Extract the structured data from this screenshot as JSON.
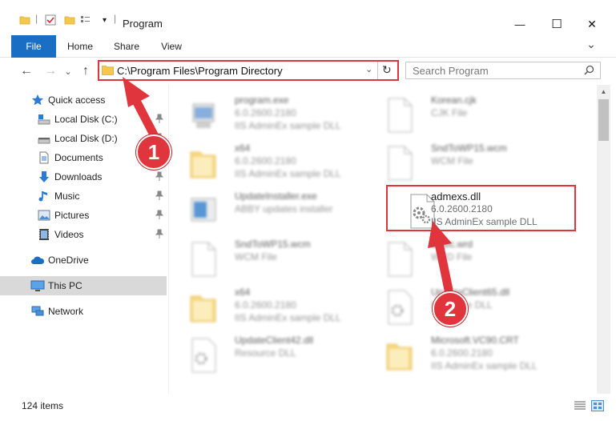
{
  "window": {
    "title": "Program",
    "minimize": "—",
    "maximize": "☐",
    "close": "✕"
  },
  "ribbon": {
    "tabs": [
      "File",
      "Home",
      "Share",
      "View"
    ],
    "expand": "⌄"
  },
  "nav": {
    "back": "←",
    "forward": "→",
    "recent": "⌄",
    "up": "↑",
    "address": "C:\\Program Files\\Program Directory",
    "address_dropdown": "⌄",
    "refresh": "↻",
    "search_placeholder": "Search Program"
  },
  "sidebar": {
    "items": [
      {
        "label": "Quick access",
        "icon": "star-icon"
      },
      {
        "label": "Local Disk (C:)",
        "icon": "drive-icon",
        "pinned": true
      },
      {
        "label": "Local Disk (D:)",
        "icon": "drive-icon",
        "pinned": true
      },
      {
        "label": "Documents",
        "icon": "documents-icon",
        "pinned": true
      },
      {
        "label": "Downloads",
        "icon": "downloads-icon",
        "pinned": true
      },
      {
        "label": "Music",
        "icon": "music-icon",
        "pinned": true
      },
      {
        "label": "Pictures",
        "icon": "pictures-icon",
        "pinned": true
      },
      {
        "label": "Videos",
        "icon": "videos-icon",
        "pinned": true
      },
      {
        "label": "OneDrive",
        "icon": "cloud-icon"
      },
      {
        "label": "This PC",
        "icon": "pc-icon",
        "selected": true
      },
      {
        "label": "Network",
        "icon": "network-icon"
      }
    ]
  },
  "files": [
    {
      "name": "program.exe",
      "line1": "6.0.2600.2180",
      "line2": "IIS AdminEx sample DLL",
      "icon": "exe-icon"
    },
    {
      "name": "Korean.cjk",
      "line1": "CJK File",
      "line2": "",
      "icon": "file-icon"
    },
    {
      "name": "x64",
      "line1": "6.0.2600.2180",
      "line2": "IIS AdminEx sample DLL",
      "icon": "folder-icon"
    },
    {
      "name": "SndToWP15.wcm",
      "line1": "WCM File",
      "line2": "",
      "icon": "file-icon"
    },
    {
      "name": "UpdateInstaller.exe",
      "line1": "ABBY updates installer",
      "line2": "",
      "icon": "installer-icon"
    },
    {
      "name": "admexs.dll",
      "line1": "6.0.2600.2180",
      "line2": "IIS AdminEx sample DLL",
      "icon": "dll-gear-icon",
      "highlighted": true
    },
    {
      "name": "SndToWP15.wcm",
      "line1": "WCM File",
      "line2": "",
      "icon": "file-icon"
    },
    {
      "name": "Basic.wrd",
      "line1": "WRD File",
      "line2": "",
      "icon": "file-icon"
    },
    {
      "name": "x64",
      "line1": "6.0.2600.2180",
      "line2": "IIS AdminEx sample DLL",
      "icon": "folder-icon"
    },
    {
      "name": "UpdateClient65.dll",
      "line1": "Resource DLL",
      "line2": "",
      "icon": "dll-gear-icon"
    },
    {
      "name": "UpdateClient42.dll",
      "line1": "Resource DLL",
      "line2": "",
      "icon": "dll-gear-icon"
    },
    {
      "name": "Microsoft.VC90.CRT",
      "line1": "6.0.2600.2180",
      "line2": "IIS AdminEx sample DLL",
      "icon": "folder-icon"
    }
  ],
  "status": {
    "count": "124 items"
  },
  "annotations": {
    "step1": "1",
    "step2": "2",
    "color": "#e0353c"
  },
  "colors": {
    "accent": "#1a6fc4",
    "highlight": "#e0353c",
    "selected": "#d9d9d9"
  }
}
